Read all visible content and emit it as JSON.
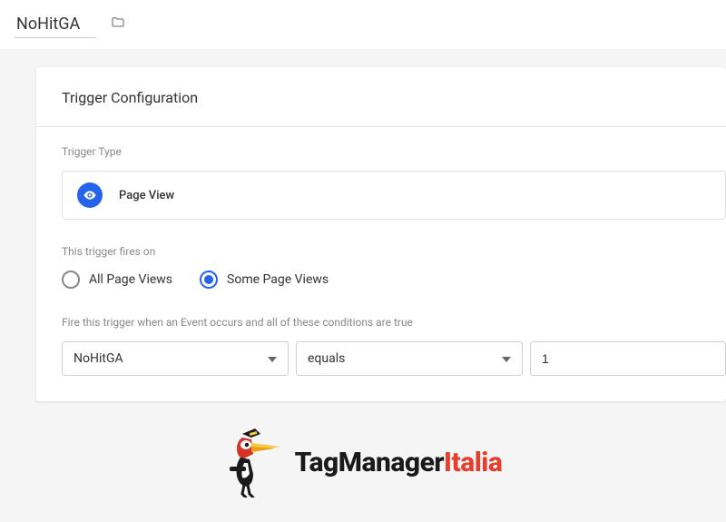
{
  "header": {
    "trigger_name": "NoHitGA"
  },
  "panel": {
    "title": "Trigger Configuration",
    "type_label": "Trigger Type",
    "type_value": "Page View",
    "fires_on_label": "This trigger fires on",
    "radio_all": "All Page Views",
    "radio_some": "Some Page Views",
    "condition_label": "Fire this trigger when an Event occurs and all of these conditions are true",
    "variable": "NoHitGA",
    "operator": "equals",
    "value": "1"
  },
  "logo": {
    "prefix": "TagManager",
    "suffix": "Italia"
  }
}
